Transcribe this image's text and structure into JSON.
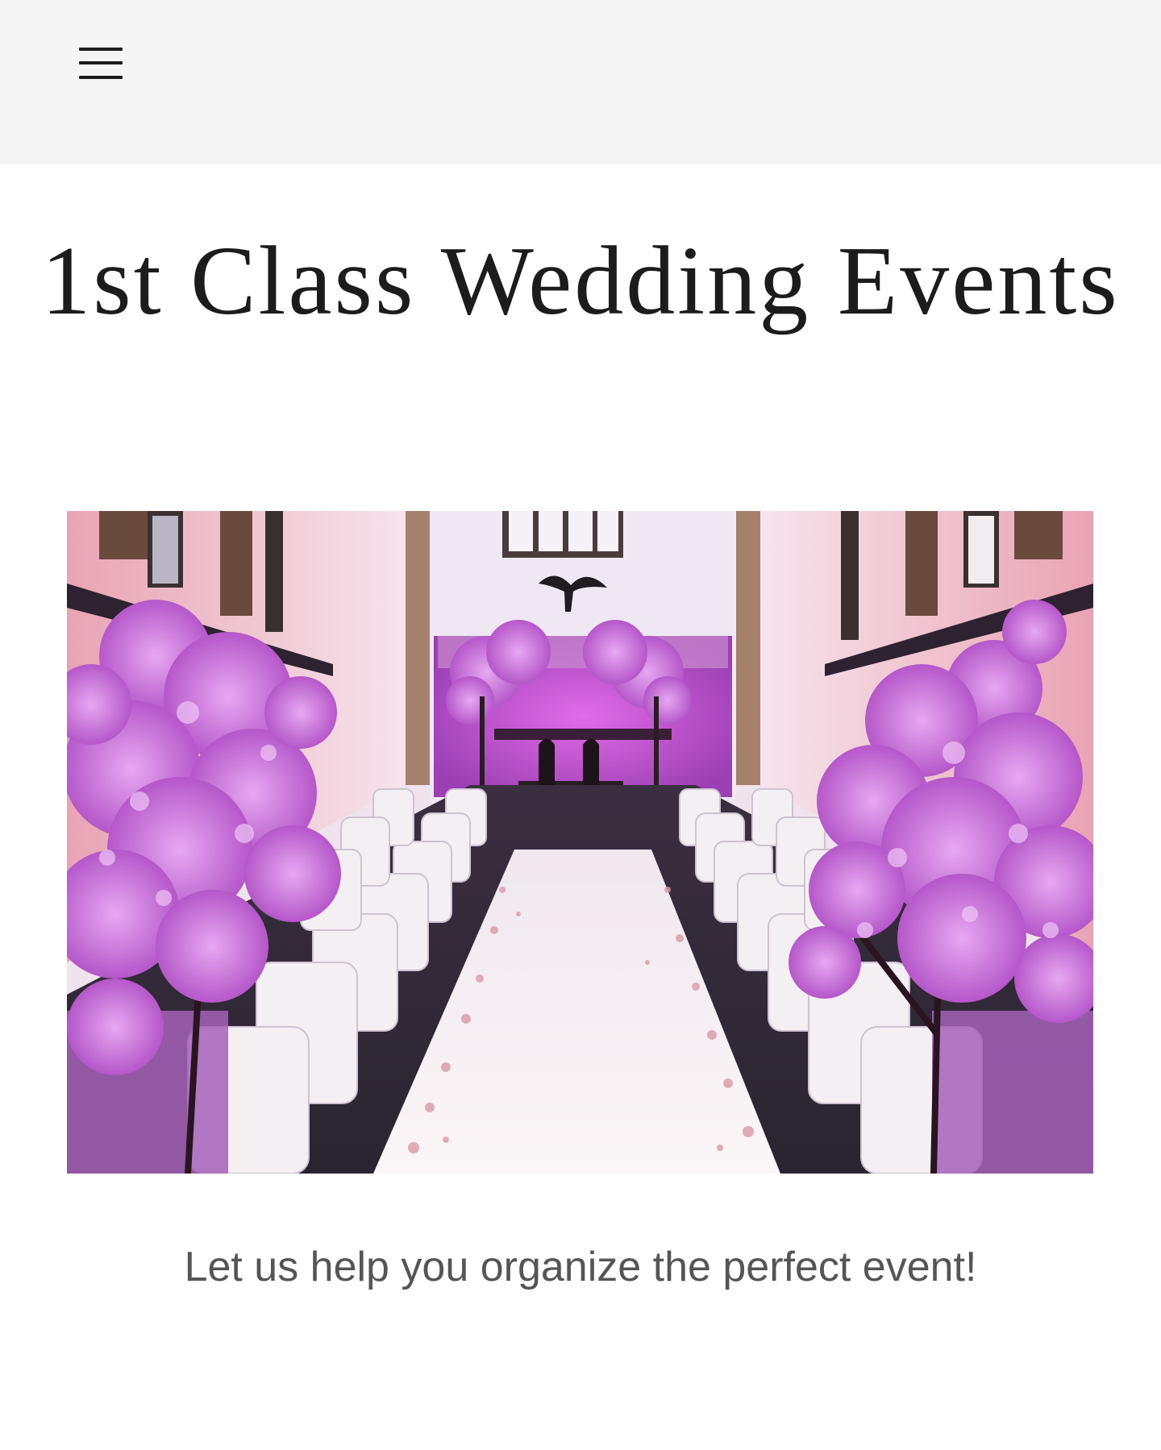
{
  "header": {
    "menu_icon": "hamburger-menu-icon"
  },
  "site": {
    "title": "1st Class Wedding Events"
  },
  "hero": {
    "image_subject": "wedding ceremony hall photo"
  },
  "tagline": "Let us help you organize the perfect event!",
  "colors": {
    "header_bg": "#f5f5f5",
    "page_bg": "#ffffff",
    "title_text": "#1c1c1c",
    "tagline_text": "#555555"
  }
}
